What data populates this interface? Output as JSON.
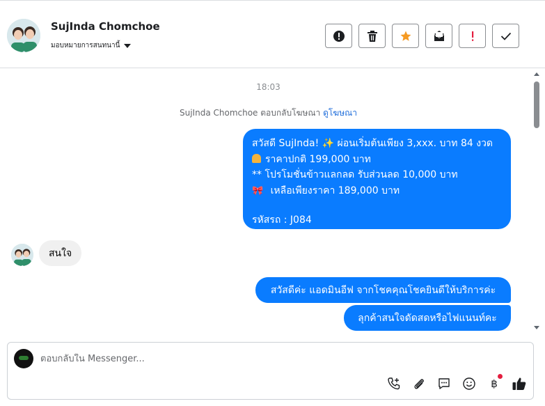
{
  "header": {
    "contact_name": "SujInda Chomchoe",
    "assign_label": "มอบหมายการสนทนานี้",
    "actions": [
      {
        "name": "spam-button",
        "icon": "exclamation-circle-icon"
      },
      {
        "name": "delete-button",
        "icon": "trash-icon"
      },
      {
        "name": "star-button",
        "icon": "star-icon"
      },
      {
        "name": "mark-unread-button",
        "icon": "envelope-icon"
      },
      {
        "name": "follow-up-button",
        "icon": "exclamation-icon"
      },
      {
        "name": "mark-done-button",
        "icon": "check-icon"
      }
    ]
  },
  "thread": {
    "timestamp": "18:03",
    "reply_note_text": "SujInda Chomchoe ตอบกลับโฆษณา",
    "reply_note_link": "ดูโฆษณา",
    "ad_message": {
      "line1": "สวัสดี SujInda! ✨  ผ่อนเริ่มต้นเพียง 3,xxx. บาท 84 งวด",
      "line2": "ราคาปกติ 199,000 บาท",
      "line3": "** โปรโมชั่นข้าวแลกลด รับส่วนลด 10,000 บาท",
      "line4": " เหลือเพียงราคา 189,000 บาท",
      "line5": "รหัสรถ : J084"
    },
    "incoming_message": "สนใจ",
    "outgoing_1": "สวัสดีค่ะ แอดมินอีฟ จากโชคคุณโชคยินดีให้บริการค่ะ",
    "outgoing_2": "ลุกค้าสนใจดัดสดหรือไฟแนนท์คะ"
  },
  "composer": {
    "placeholder": "ตอบกลับใน Messenger...",
    "tools": [
      "phone-plus-icon",
      "paperclip-icon",
      "chat-bubble-icon",
      "smiley-icon",
      "baht-icon",
      "thumbs-up-icon"
    ],
    "baht_symbol": "฿"
  },
  "colors": {
    "outgoing_bubble": "#0a7cff",
    "incoming_bubble": "#f0f0f0",
    "star": "#f59a23",
    "alert_red": "#e41e3f"
  }
}
